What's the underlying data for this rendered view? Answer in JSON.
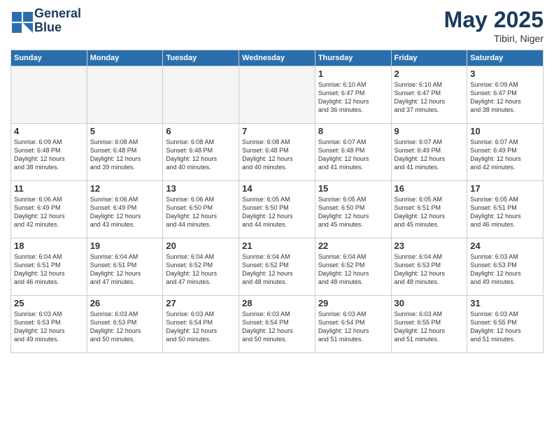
{
  "header": {
    "logo_line1": "General",
    "logo_line2": "Blue",
    "month": "May 2025",
    "location": "Tibiri, Niger"
  },
  "days_of_week": [
    "Sunday",
    "Monday",
    "Tuesday",
    "Wednesday",
    "Thursday",
    "Friday",
    "Saturday"
  ],
  "weeks": [
    [
      {
        "day": "",
        "info": ""
      },
      {
        "day": "",
        "info": ""
      },
      {
        "day": "",
        "info": ""
      },
      {
        "day": "",
        "info": ""
      },
      {
        "day": "1",
        "info": "Sunrise: 6:10 AM\nSunset: 6:47 PM\nDaylight: 12 hours\nand 36 minutes."
      },
      {
        "day": "2",
        "info": "Sunrise: 6:10 AM\nSunset: 6:47 PM\nDaylight: 12 hours\nand 37 minutes."
      },
      {
        "day": "3",
        "info": "Sunrise: 6:09 AM\nSunset: 6:47 PM\nDaylight: 12 hours\nand 38 minutes."
      }
    ],
    [
      {
        "day": "4",
        "info": "Sunrise: 6:09 AM\nSunset: 6:48 PM\nDaylight: 12 hours\nand 38 minutes."
      },
      {
        "day": "5",
        "info": "Sunrise: 6:08 AM\nSunset: 6:48 PM\nDaylight: 12 hours\nand 39 minutes."
      },
      {
        "day": "6",
        "info": "Sunrise: 6:08 AM\nSunset: 6:48 PM\nDaylight: 12 hours\nand 40 minutes."
      },
      {
        "day": "7",
        "info": "Sunrise: 6:08 AM\nSunset: 6:48 PM\nDaylight: 12 hours\nand 40 minutes."
      },
      {
        "day": "8",
        "info": "Sunrise: 6:07 AM\nSunset: 6:48 PM\nDaylight: 12 hours\nand 41 minutes."
      },
      {
        "day": "9",
        "info": "Sunrise: 6:07 AM\nSunset: 6:49 PM\nDaylight: 12 hours\nand 41 minutes."
      },
      {
        "day": "10",
        "info": "Sunrise: 6:07 AM\nSunset: 6:49 PM\nDaylight: 12 hours\nand 42 minutes."
      }
    ],
    [
      {
        "day": "11",
        "info": "Sunrise: 6:06 AM\nSunset: 6:49 PM\nDaylight: 12 hours\nand 42 minutes."
      },
      {
        "day": "12",
        "info": "Sunrise: 6:06 AM\nSunset: 6:49 PM\nDaylight: 12 hours\nand 43 minutes."
      },
      {
        "day": "13",
        "info": "Sunrise: 6:06 AM\nSunset: 6:50 PM\nDaylight: 12 hours\nand 44 minutes."
      },
      {
        "day": "14",
        "info": "Sunrise: 6:05 AM\nSunset: 6:50 PM\nDaylight: 12 hours\nand 44 minutes."
      },
      {
        "day": "15",
        "info": "Sunrise: 6:05 AM\nSunset: 6:50 PM\nDaylight: 12 hours\nand 45 minutes."
      },
      {
        "day": "16",
        "info": "Sunrise: 6:05 AM\nSunset: 6:51 PM\nDaylight: 12 hours\nand 45 minutes."
      },
      {
        "day": "17",
        "info": "Sunrise: 6:05 AM\nSunset: 6:51 PM\nDaylight: 12 hours\nand 46 minutes."
      }
    ],
    [
      {
        "day": "18",
        "info": "Sunrise: 6:04 AM\nSunset: 6:51 PM\nDaylight: 12 hours\nand 46 minutes."
      },
      {
        "day": "19",
        "info": "Sunrise: 6:04 AM\nSunset: 6:51 PM\nDaylight: 12 hours\nand 47 minutes."
      },
      {
        "day": "20",
        "info": "Sunrise: 6:04 AM\nSunset: 6:52 PM\nDaylight: 12 hours\nand 47 minutes."
      },
      {
        "day": "21",
        "info": "Sunrise: 6:04 AM\nSunset: 6:52 PM\nDaylight: 12 hours\nand 48 minutes."
      },
      {
        "day": "22",
        "info": "Sunrise: 6:04 AM\nSunset: 6:52 PM\nDaylight: 12 hours\nand 48 minutes."
      },
      {
        "day": "23",
        "info": "Sunrise: 6:04 AM\nSunset: 6:53 PM\nDaylight: 12 hours\nand 48 minutes."
      },
      {
        "day": "24",
        "info": "Sunrise: 6:03 AM\nSunset: 6:53 PM\nDaylight: 12 hours\nand 49 minutes."
      }
    ],
    [
      {
        "day": "25",
        "info": "Sunrise: 6:03 AM\nSunset: 6:53 PM\nDaylight: 12 hours\nand 49 minutes."
      },
      {
        "day": "26",
        "info": "Sunrise: 6:03 AM\nSunset: 6:53 PM\nDaylight: 12 hours\nand 50 minutes."
      },
      {
        "day": "27",
        "info": "Sunrise: 6:03 AM\nSunset: 6:54 PM\nDaylight: 12 hours\nand 50 minutes."
      },
      {
        "day": "28",
        "info": "Sunrise: 6:03 AM\nSunset: 6:54 PM\nDaylight: 12 hours\nand 50 minutes."
      },
      {
        "day": "29",
        "info": "Sunrise: 6:03 AM\nSunset: 6:54 PM\nDaylight: 12 hours\nand 51 minutes."
      },
      {
        "day": "30",
        "info": "Sunrise: 6:03 AM\nSunset: 6:55 PM\nDaylight: 12 hours\nand 51 minutes."
      },
      {
        "day": "31",
        "info": "Sunrise: 6:03 AM\nSunset: 6:55 PM\nDaylight: 12 hours\nand 51 minutes."
      }
    ]
  ]
}
